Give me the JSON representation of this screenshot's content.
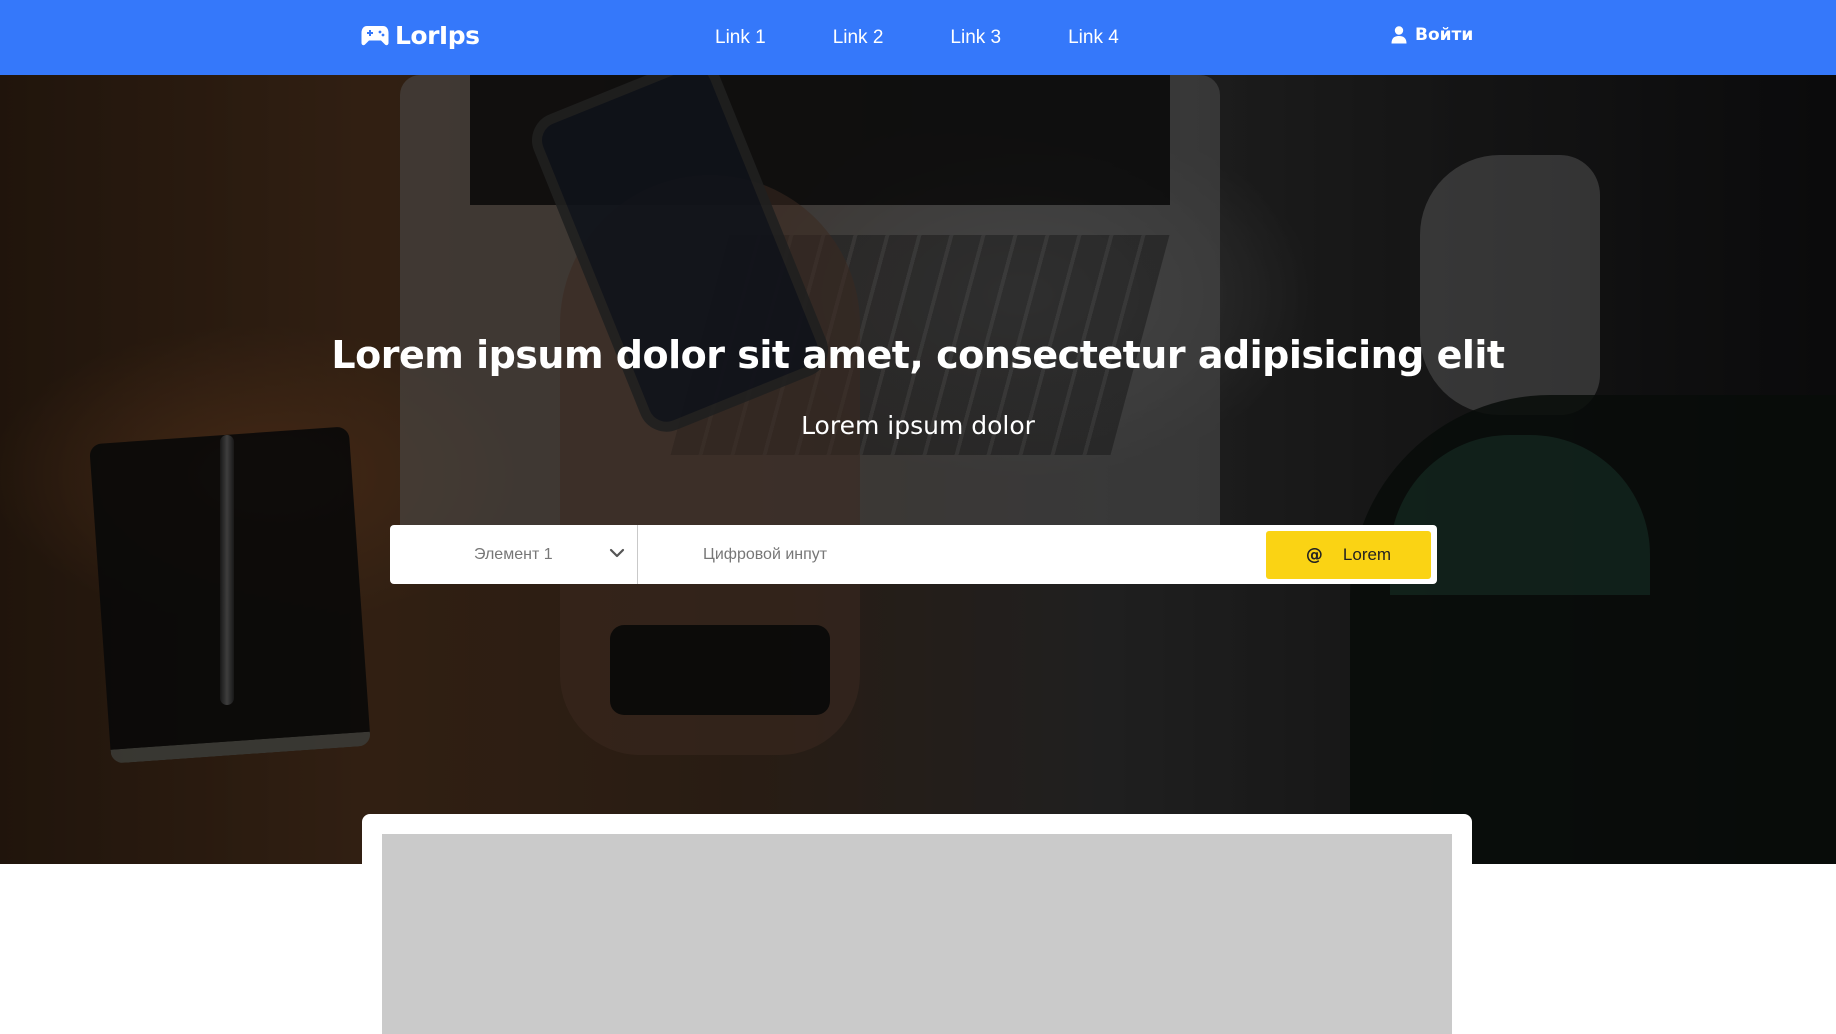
{
  "brand": {
    "name": "LorIps",
    "icon": "gamepad-icon"
  },
  "nav": {
    "links": [
      {
        "label": "Link 1"
      },
      {
        "label": "Link 2"
      },
      {
        "label": "Link 3"
      },
      {
        "label": "Link 4"
      }
    ],
    "login": {
      "label": "Войти",
      "icon": "user-icon"
    }
  },
  "hero": {
    "title": "Lorem ipsum dolor sit amet, consectetur adipisicing elit",
    "subtitle": "Lorem ipsum dolor",
    "search": {
      "select_value": "Элемент 1",
      "input_placeholder": "Цифровой инпут",
      "input_value": "",
      "button_label": "Lorem",
      "button_icon": "at-icon"
    }
  },
  "colors": {
    "navbar": "#3578fa",
    "accent": "#fad314",
    "text_on_dark": "#ffffff"
  }
}
